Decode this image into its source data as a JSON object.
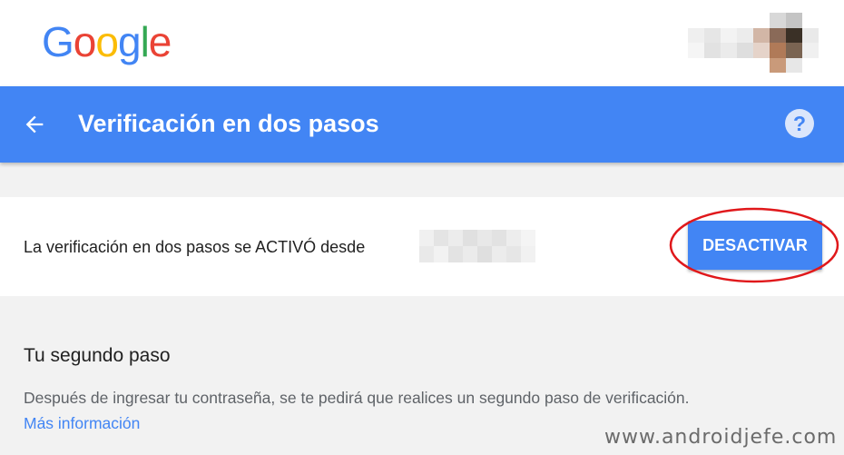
{
  "header": {
    "logo_letters": [
      "G",
      "o",
      "o",
      "g",
      "l",
      "e"
    ]
  },
  "titlebar": {
    "title": "Verificación en dos pasos",
    "back_icon": "arrow-back-icon",
    "help_icon": "help-circle-icon",
    "help_symbol": "?",
    "color": "#4285f4"
  },
  "status": {
    "text": "La verificación en dos pasos se ACTIVÓ desde",
    "button_label": "DESACTIVAR",
    "highlight_color": "#e0181b"
  },
  "second_step": {
    "title": "Tu segundo paso",
    "description": "Después de ingresar tu contraseña, se te pedirá que realices un segundo paso de verificación.",
    "link": "Más información"
  },
  "watermark": "www.androidjefe.com"
}
